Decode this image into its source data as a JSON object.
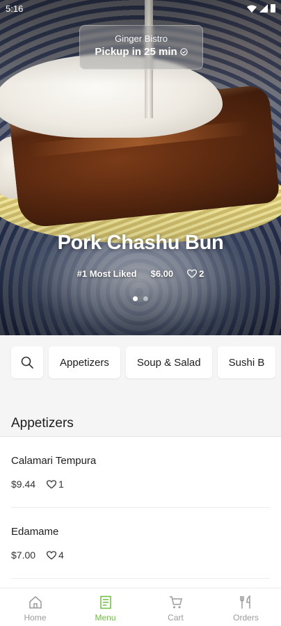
{
  "status_bar": {
    "time": "5:16"
  },
  "pickup": {
    "store": "Ginger Bistro",
    "time_text": "Pickup in 25 min"
  },
  "featured": {
    "title": "Pork Chashu Bun",
    "rank": "#1 Most Liked",
    "price": "$6.00",
    "likes": "2",
    "carousel_total": 2,
    "carousel_active": 1
  },
  "categories": {
    "items": [
      {
        "label": "Appetizers"
      },
      {
        "label": "Soup & Salad"
      },
      {
        "label": "Sushi B"
      }
    ]
  },
  "section": {
    "title": "Appetizers"
  },
  "menu_items": [
    {
      "name": "Calamari Tempura",
      "price": "$9.44",
      "likes": "1"
    },
    {
      "name": "Edamame",
      "price": "$7.00",
      "likes": "4"
    }
  ],
  "bottom_nav": {
    "items": [
      {
        "label": "Home",
        "icon": "home-icon"
      },
      {
        "label": "Menu",
        "icon": "menu-icon",
        "active": true
      },
      {
        "label": "Cart",
        "icon": "cart-icon"
      },
      {
        "label": "Orders",
        "icon": "orders-icon"
      }
    ]
  },
  "colors": {
    "accent": "#6bbf3c",
    "chip_bg": "#ffffff",
    "section_bg": "#f5f5f5"
  }
}
